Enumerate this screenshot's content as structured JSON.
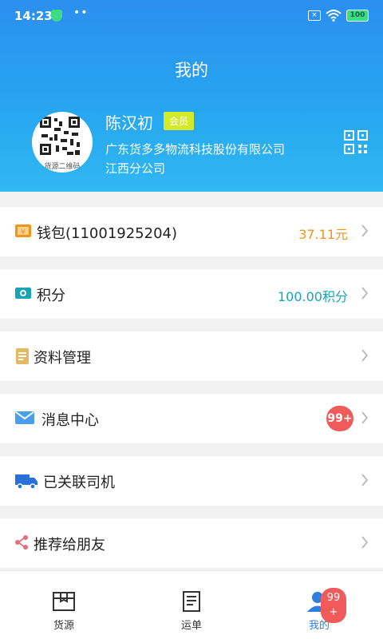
{
  "status_bar": {
    "time": "14:23",
    "battery": "100"
  },
  "header": {
    "title": "我的"
  },
  "user": {
    "avatar_caption": "货源二维码",
    "name": "陈汉初",
    "badge": "会员",
    "company_line1": "广东货多多物流科技股份有限公司",
    "company_line2": "江西分公司"
  },
  "menu": {
    "wallet": {
      "label": "钱包(11001925204)",
      "value": "37.11元"
    },
    "points": {
      "label": "积分",
      "value": "100.00积分"
    },
    "profile": {
      "label": "资料管理"
    },
    "messages": {
      "label": "消息中心",
      "badge": "99+"
    },
    "drivers": {
      "label": "已关联司机"
    },
    "share": {
      "label": "推荐给朋友"
    }
  },
  "tabbar": {
    "tabs": [
      {
        "label": "货源"
      },
      {
        "label": "运单"
      },
      {
        "label": "我的"
      }
    ],
    "badge_line1": "99",
    "badge_line2": "+"
  },
  "colors": {
    "header": "#2b8ff0",
    "wallet_value": "#f0951b",
    "points_value": "#1aa3b8",
    "badge": "#f05a5a",
    "member_badge": "#d4e92a",
    "active_tab": "#2f7fde"
  },
  "icons": [
    "wallet-icon",
    "points-icon",
    "profile-icon",
    "mail-icon",
    "truck-icon",
    "share-icon",
    "qr-code-icon",
    "chevron-right-icon"
  ]
}
